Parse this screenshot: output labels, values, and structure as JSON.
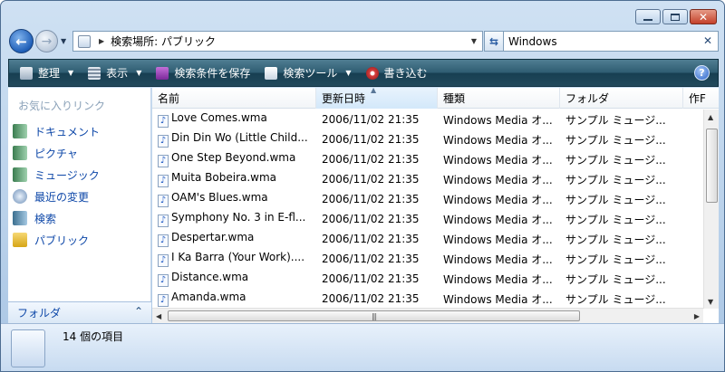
{
  "window": {
    "caption_buttons": [
      "minimize",
      "maximize",
      "close"
    ]
  },
  "nav": {
    "address_text": "検索場所: パブリック",
    "search_value": "Windows"
  },
  "toolbar": {
    "organize": "整理",
    "view": "表示",
    "save_search": "検索条件を保存",
    "search_tools": "検索ツール",
    "burn": "書き込む"
  },
  "left_pane": {
    "header": "お気に入りリンク",
    "items": [
      {
        "label": "ドキュメント",
        "icon": "documents-icon"
      },
      {
        "label": "ピクチャ",
        "icon": "pictures-icon"
      },
      {
        "label": "ミュージック",
        "icon": "music-icon"
      },
      {
        "label": "最近の変更",
        "icon": "recent-icon"
      },
      {
        "label": "検索",
        "icon": "search-folder-icon"
      },
      {
        "label": "パブリック",
        "icon": "public-folder-icon"
      }
    ],
    "folder_label": "フォルダ"
  },
  "list": {
    "columns": [
      "名前",
      "更新日時",
      "種類",
      "フォルダ",
      "作F"
    ],
    "rows": [
      {
        "name": "Love Comes.wma",
        "date": "2006/11/02 21:35",
        "type": "Windows Media オ...",
        "folder": "サンプル ミュージ..."
      },
      {
        "name": "Din Din Wo (Little Child...",
        "date": "2006/11/02 21:35",
        "type": "Windows Media オ...",
        "folder": "サンプル ミュージ..."
      },
      {
        "name": "One Step Beyond.wma",
        "date": "2006/11/02 21:35",
        "type": "Windows Media オ...",
        "folder": "サンプル ミュージ..."
      },
      {
        "name": "Muita Bobeira.wma",
        "date": "2006/11/02 21:35",
        "type": "Windows Media オ...",
        "folder": "サンプル ミュージ..."
      },
      {
        "name": "OAM's Blues.wma",
        "date": "2006/11/02 21:35",
        "type": "Windows Media オ...",
        "folder": "サンプル ミュージ..."
      },
      {
        "name": "Symphony No. 3 in E-fl...",
        "date": "2006/11/02 21:35",
        "type": "Windows Media オ...",
        "folder": "サンプル ミュージ..."
      },
      {
        "name": "Despertar.wma",
        "date": "2006/11/02 21:35",
        "type": "Windows Media オ...",
        "folder": "サンプル ミュージ..."
      },
      {
        "name": "I Ka Barra (Your Work)....",
        "date": "2006/11/02 21:35",
        "type": "Windows Media オ...",
        "folder": "サンプル ミュージ..."
      },
      {
        "name": "Distance.wma",
        "date": "2006/11/02 21:35",
        "type": "Windows Media オ...",
        "folder": "サンプル ミュージ..."
      },
      {
        "name": "Amanda.wma",
        "date": "2006/11/02 21:35",
        "type": "Windows Media オ...",
        "folder": "サンプル ミュージ..."
      }
    ]
  },
  "details": {
    "item_count": "14 個の項目"
  }
}
